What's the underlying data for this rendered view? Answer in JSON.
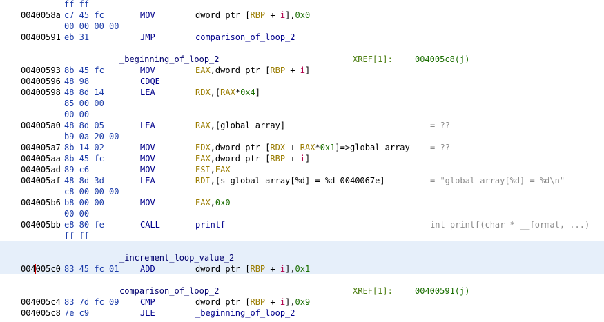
{
  "lines": [
    {
      "bytes": "ff ff"
    },
    {
      "addr": "0040058a",
      "bytes": "c7 45 fc",
      "mnemonic": "MOV",
      "operands": [
        {
          "t": "txt",
          "s": "dword ptr ["
        },
        {
          "t": "reg",
          "s": "RBP"
        },
        {
          "t": "txt",
          "s": " + "
        },
        {
          "t": "var",
          "s": "i"
        },
        {
          "t": "txt",
          "s": "],"
        },
        {
          "t": "num",
          "s": "0x0"
        }
      ]
    },
    {
      "bytes": "00 00 00 00"
    },
    {
      "addr": "00400591",
      "bytes": "eb 31",
      "mnemonic": "JMP",
      "operands": [
        {
          "t": "sym",
          "s": "comparison_of_loop_2"
        }
      ]
    },
    {
      "blank": true
    },
    {
      "label": "_beginning_of_loop_2",
      "xref": "XREF[1]:",
      "xref_addr": "004005c8(j)"
    },
    {
      "addr": "00400593",
      "bytes": "8b 45 fc",
      "mnemonic": "MOV",
      "operands": [
        {
          "t": "reg",
          "s": "EAX"
        },
        {
          "t": "txt",
          "s": ",dword ptr ["
        },
        {
          "t": "reg",
          "s": "RBP"
        },
        {
          "t": "txt",
          "s": " + "
        },
        {
          "t": "var",
          "s": "i"
        },
        {
          "t": "txt",
          "s": "]"
        }
      ]
    },
    {
      "addr": "00400596",
      "bytes": "48 98",
      "mnemonic": "CDQE"
    },
    {
      "addr": "00400598",
      "bytes": "48 8d 14",
      "mnemonic": "LEA",
      "operands": [
        {
          "t": "reg",
          "s": "RDX"
        },
        {
          "t": "txt",
          "s": ",["
        },
        {
          "t": "reg",
          "s": "RAX"
        },
        {
          "t": "txt",
          "s": "*"
        },
        {
          "t": "num",
          "s": "0x4"
        },
        {
          "t": "txt",
          "s": "]"
        }
      ]
    },
    {
      "bytes": "85 00 00"
    },
    {
      "bytes": "00 00"
    },
    {
      "addr": "004005a0",
      "bytes": "48 8d 05",
      "mnemonic": "LEA",
      "operands": [
        {
          "t": "reg",
          "s": "RAX"
        },
        {
          "t": "txt",
          "s": ",[global_array]"
        }
      ],
      "comment": "= ??"
    },
    {
      "bytes": "b9 0a 20 00"
    },
    {
      "addr": "004005a7",
      "bytes": "8b 14 02",
      "mnemonic": "MOV",
      "operands": [
        {
          "t": "reg",
          "s": "EDX"
        },
        {
          "t": "txt",
          "s": ",dword ptr ["
        },
        {
          "t": "reg",
          "s": "RDX"
        },
        {
          "t": "txt",
          "s": " + "
        },
        {
          "t": "reg",
          "s": "RAX"
        },
        {
          "t": "txt",
          "s": "*"
        },
        {
          "t": "num",
          "s": "0x1"
        },
        {
          "t": "txt",
          "s": "]=>global_array"
        }
      ],
      "comment": "= ??"
    },
    {
      "addr": "004005aa",
      "bytes": "8b 45 fc",
      "mnemonic": "MOV",
      "operands": [
        {
          "t": "reg",
          "s": "EAX"
        },
        {
          "t": "txt",
          "s": ",dword ptr ["
        },
        {
          "t": "reg",
          "s": "RBP"
        },
        {
          "t": "txt",
          "s": " + "
        },
        {
          "t": "var",
          "s": "i"
        },
        {
          "t": "txt",
          "s": "]"
        }
      ]
    },
    {
      "addr": "004005ad",
      "bytes": "89 c6",
      "mnemonic": "MOV",
      "operands": [
        {
          "t": "reg",
          "s": "ESI"
        },
        {
          "t": "txt",
          "s": ","
        },
        {
          "t": "reg",
          "s": "EAX"
        }
      ]
    },
    {
      "addr": "004005af",
      "bytes": "48 8d 3d",
      "mnemonic": "LEA",
      "operands": [
        {
          "t": "reg",
          "s": "RDI"
        },
        {
          "t": "txt",
          "s": ",[s_global_array[%d]_=_%d_0040067e]"
        }
      ],
      "comment": "= \"global_array[%d] = %d\\n\""
    },
    {
      "bytes": "c8 00 00 00"
    },
    {
      "addr": "004005b6",
      "bytes": "b8 00 00",
      "mnemonic": "MOV",
      "operands": [
        {
          "t": "reg",
          "s": "EAX"
        },
        {
          "t": "txt",
          "s": ","
        },
        {
          "t": "num",
          "s": "0x0"
        }
      ]
    },
    {
      "bytes": "00 00"
    },
    {
      "addr": "004005bb",
      "bytes": "e8 80 fe",
      "mnemonic": "CALL",
      "operands": [
        {
          "t": "sym",
          "s": "printf"
        }
      ],
      "comment": "int printf(char * __format, ...)"
    },
    {
      "bytes": "ff ff"
    },
    {
      "blank": true,
      "highlight": true
    },
    {
      "label": "_increment_loop_value_2",
      "highlight": true
    },
    {
      "addr": "004005c0",
      "bytes": "83 45 fc 01",
      "mnemonic": "ADD",
      "highlight": true,
      "cursor": true,
      "operands": [
        {
          "t": "txt",
          "s": "dword ptr ["
        },
        {
          "t": "reg",
          "s": "RBP"
        },
        {
          "t": "txt",
          "s": " + "
        },
        {
          "t": "var",
          "s": "i"
        },
        {
          "t": "txt",
          "s": "],"
        },
        {
          "t": "num",
          "s": "0x1"
        }
      ]
    },
    {
      "blank": true
    },
    {
      "label": "comparison_of_loop_2",
      "xref": "XREF[1]:",
      "xref_addr": "00400591(j)"
    },
    {
      "addr": "004005c4",
      "bytes": "83 7d fc 09",
      "mnemonic": "CMP",
      "operands": [
        {
          "t": "txt",
          "s": "dword ptr ["
        },
        {
          "t": "reg",
          "s": "RBP"
        },
        {
          "t": "txt",
          "s": " + "
        },
        {
          "t": "var",
          "s": "i"
        },
        {
          "t": "txt",
          "s": "],"
        },
        {
          "t": "num",
          "s": "0x9"
        }
      ]
    },
    {
      "addr": "004005c8",
      "bytes": "7e c9",
      "mnemonic": "JLE",
      "operands": [
        {
          "t": "sym",
          "s": "_beginning_of_loop_2"
        }
      ]
    }
  ]
}
